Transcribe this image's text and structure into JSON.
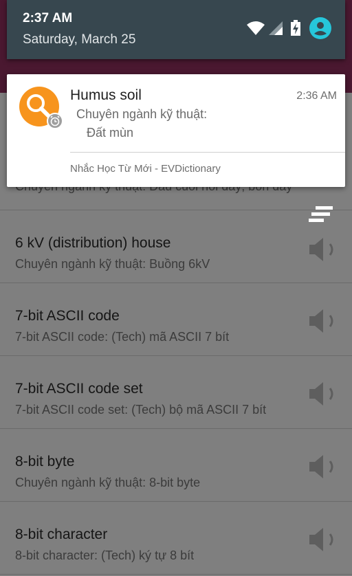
{
  "status_bar": {
    "time": "2:37 AM",
    "date": "Saturday, March 25",
    "icons": [
      "wifi-icon",
      "cellular-signal-icon",
      "battery-charging-icon",
      "account-icon"
    ]
  },
  "notification": {
    "title": "Humus soil",
    "time": "2:36 AM",
    "line1": "Chuyên ngành kỹ thuật:",
    "line2": "Đất mùn",
    "app_name": "Nhắc Học Từ Mới - EVDictionary",
    "icon": "magnifier-icon",
    "badge_icon": "alarm-clock-icon",
    "accent_color": "#f7941d"
  },
  "list": {
    "partial_item_subtitle": "Chuyên ngành kỹ thuật: Đầu cuối nối dây; bốn dây",
    "items": [
      {
        "title": "6 kV (distribution) house",
        "subtitle": "Chuyên ngành kỹ thuật: Buồng 6kV"
      },
      {
        "title": "7-bit ASCII code",
        "subtitle": "7-bit ASCII code: (Tech) mã ASCII 7 bít"
      },
      {
        "title": "7-bit ASCII code set",
        "subtitle": "7-bit ASCII code set: (Tech) bộ mã ASCII 7 bít"
      },
      {
        "title": "8-bit byte",
        "subtitle": "Chuyên ngành kỹ thuật: 8-bit byte"
      },
      {
        "title": "8-bit character",
        "subtitle": "8-bit character: (Tech) ký tự 8 bít"
      }
    ],
    "speaker_icon": "speaker-icon",
    "fab_icon": "menu-lines-icon"
  }
}
